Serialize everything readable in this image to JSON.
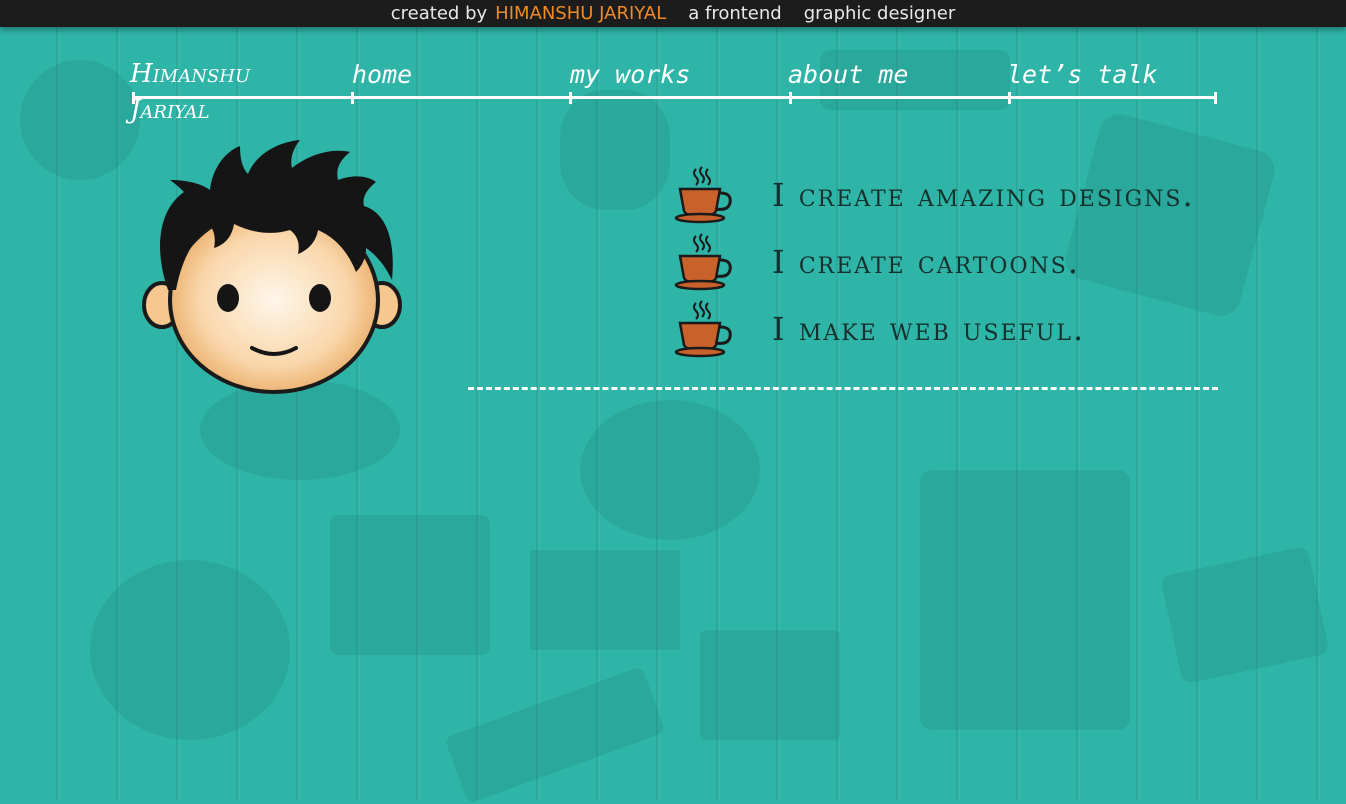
{
  "topbar": {
    "created_by": "created by",
    "name": "HIMANSHU JARIYAL",
    "role_1": "a frontend",
    "role_2": "graphic designer"
  },
  "logo": {
    "line1": "Himanshu",
    "line2": "Jariyal"
  },
  "nav": {
    "home": "home",
    "works": "my works",
    "about": "about me",
    "talk": "let’s talk"
  },
  "features": [
    {
      "text": "I create amazing designs.",
      "icon": "coffee-cup-icon"
    },
    {
      "text": "I create cartoons.",
      "icon": "coffee-cup-icon"
    },
    {
      "text": "I make web useful.",
      "icon": "coffee-cup-icon"
    }
  ],
  "colors": {
    "background": "#2fb5a8",
    "topbar": "#1c1c1c",
    "accent": "#f08a24",
    "text_dark": "#14312d",
    "cup": "#c8612a"
  }
}
